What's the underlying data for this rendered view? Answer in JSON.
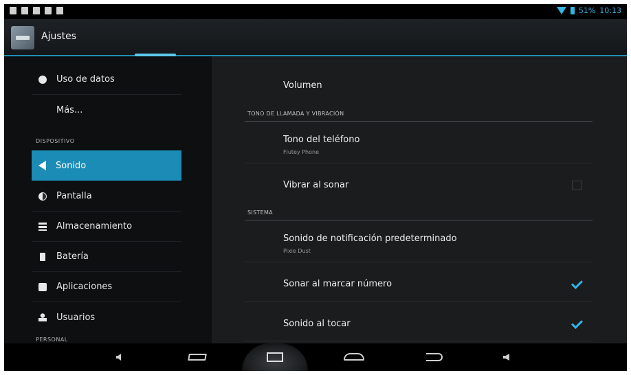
{
  "status_bar": {
    "time": "10:13",
    "battery": "51%"
  },
  "action_bar": {
    "title": "Ajustes"
  },
  "sidebar": {
    "items": [
      {
        "label": "Uso de datos"
      },
      {
        "label": "Más..."
      },
      {
        "label": "Sonido"
      },
      {
        "label": "Pantalla"
      },
      {
        "label": "Almacenamiento"
      },
      {
        "label": "Batería"
      },
      {
        "label": "Aplicaciones"
      },
      {
        "label": "Usuarios"
      }
    ],
    "sections": {
      "device": "DISPOSITIVO",
      "personal": "PERSONAL"
    },
    "selected": "Sonido"
  },
  "detail": {
    "volume": "Volumen",
    "section_ringtone": "TONO DE LLAMADA Y VIBRACIÓN",
    "ringtone": {
      "title": "Tono del teléfono",
      "subtitle": "Flutey Phone"
    },
    "vibrate": {
      "title": "Vibrar al sonar",
      "checked": false
    },
    "section_system": "SISTEMA",
    "notification": {
      "title": "Sonido de notificación predeterminado",
      "subtitle": "Pixie Dust"
    },
    "dial_tones": {
      "title": "Sonar al marcar número",
      "checked": true
    },
    "touch_sounds": {
      "title": "Sonido al tocar",
      "checked": true
    }
  },
  "icons": {
    "sidebar": [
      "data-usage-icon",
      "sound-icon",
      "display-icon",
      "storage-icon",
      "battery-icon",
      "apps-icon",
      "users-icon"
    ],
    "navbar": [
      "volume-down-icon",
      "recents-icon",
      "screenshot-icon",
      "home-icon",
      "back-icon",
      "volume-up-icon"
    ]
  },
  "colors": {
    "accent": "#33b5e5",
    "selected": "#1b8cb6"
  }
}
